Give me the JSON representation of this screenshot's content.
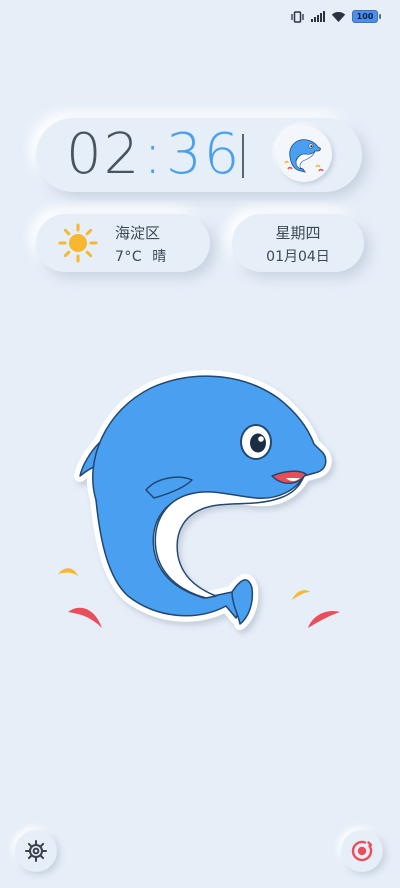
{
  "status_bar": {
    "icons": [
      "vibrate-icon",
      "signal-icon",
      "wifi-icon"
    ],
    "battery_level": "100"
  },
  "clock": {
    "hours": "02",
    "separator": ":",
    "minutes": "36",
    "accent_color": "#4a9ff0"
  },
  "avatar": {
    "icon": "dolphin-avatar-icon"
  },
  "weather": {
    "icon": "sun-icon",
    "location": "海淀区",
    "temperature": "7°C",
    "condition": "晴"
  },
  "date": {
    "weekday": "星期四",
    "day": "01月04日"
  },
  "wallpaper": {
    "illustration": "dolphin-illustration"
  },
  "bottom_controls": {
    "left_icon": "gear-icon",
    "right_icon": "camera-record-icon"
  },
  "colors": {
    "background": "#e6eef8",
    "dolphin_blue": "#4a9ff0",
    "text": "#3e4855",
    "sun": "#f7b731",
    "accent_red": "#e94e5a"
  }
}
